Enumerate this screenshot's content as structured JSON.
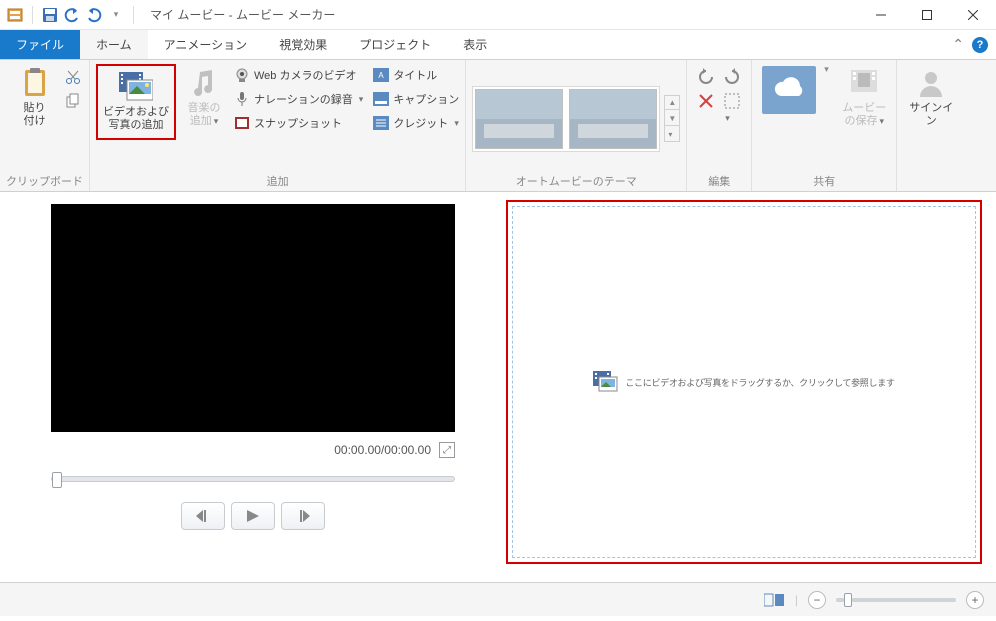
{
  "titlebar": {
    "title": "マイ ムービー - ムービー メーカー"
  },
  "tabs": {
    "file": "ファイル",
    "home": "ホーム",
    "animation": "アニメーション",
    "visual": "視覚効果",
    "project": "プロジェクト",
    "view": "表示"
  },
  "ribbon": {
    "clipboard": {
      "label": "クリップボード",
      "paste": "貼り\n付け"
    },
    "add": {
      "label": "追加",
      "add_video_photo": "ビデオおよび\n写真の追加",
      "add_music": "音楽の\n追加",
      "webcam": "Web カメラのビデオ",
      "narration": "ナレーションの録音",
      "snapshot": "スナップショット",
      "title": "タイトル",
      "caption": "キャプション",
      "credit": "クレジット"
    },
    "automovie": {
      "label": "オートムービーのテーマ"
    },
    "edit": {
      "label": "編集"
    },
    "share": {
      "label": "共有",
      "save_movie": "ムービー\nの保存"
    },
    "signin": "サインイン"
  },
  "preview": {
    "time": "00:00.00/00:00.00"
  },
  "timeline": {
    "hint": "ここにビデオおよび写真をドラッグするか、クリックして参照します"
  }
}
